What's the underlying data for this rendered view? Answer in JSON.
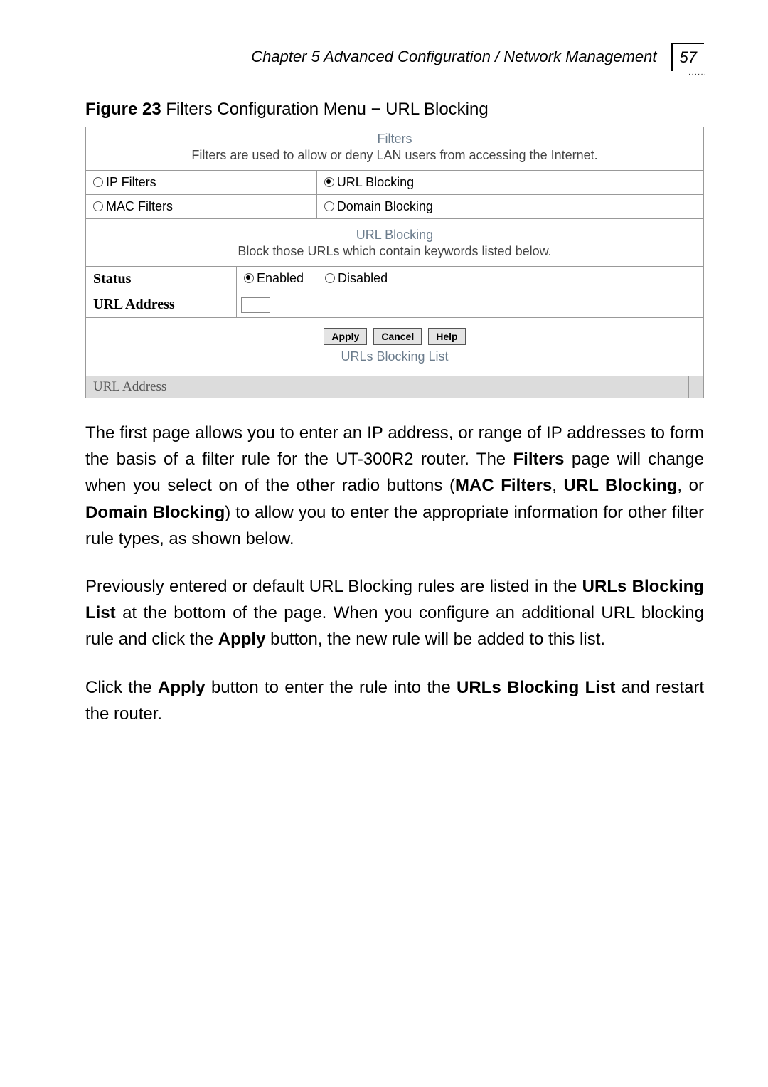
{
  "header": {
    "chapter": "Chapter 5 Advanced Configuration / Network Management",
    "page_number": "57"
  },
  "figure_caption": {
    "label": "Figure 23",
    "text": " Filters Configuration Menu − URL Blocking"
  },
  "filters_panel": {
    "title": "Filters",
    "subtitle": "Filters are used to allow or deny LAN users from accessing the Internet.",
    "options": {
      "ip_filters": "IP Filters",
      "url_blocking": "URL Blocking",
      "mac_filters": "MAC Filters",
      "domain_blocking": "Domain Blocking"
    },
    "url_blocking_title": "URL Blocking",
    "url_blocking_sub": "Block those URLs which contain keywords listed below.",
    "status_label": "Status",
    "status_enabled": "Enabled",
    "status_disabled": "Disabled",
    "url_address_label": "URL Address",
    "buttons": {
      "apply": "Apply",
      "cancel": "Cancel",
      "help": "Help"
    },
    "urls_blocking_list_title": "URLs Blocking List",
    "urls_blocking_list_col": "URL Address"
  },
  "paragraphs": {
    "p1_a": "The first page allows you to enter an IP address, or range of IP addresses to form the basis of a filter rule for the UT-300R2 router. The ",
    "p1_b": "Filters",
    "p1_c": " page will change when you select on of the other radio buttons (",
    "p1_d": "MAC Filters",
    "p1_e": ", ",
    "p1_f": "URL Blocking",
    "p1_g": ", or ",
    "p1_h": "Domain Blocking",
    "p1_i": ") to allow you to enter the appropriate information for other filter rule types, as shown below.",
    "p2_a": "Previously entered or default URL Blocking rules are listed in the ",
    "p2_b": "URLs Blocking List",
    "p2_c": " at the bottom of the page. When you configure an additional URL blocking rule and click the ",
    "p2_d": "Apply",
    "p2_e": " button, the new rule will be added to this list.",
    "p3_a": "Click the ",
    "p3_b": "Apply",
    "p3_c": " button to enter the rule into the ",
    "p3_d": "URLs Blocking List",
    "p3_e": " and restart the router."
  }
}
